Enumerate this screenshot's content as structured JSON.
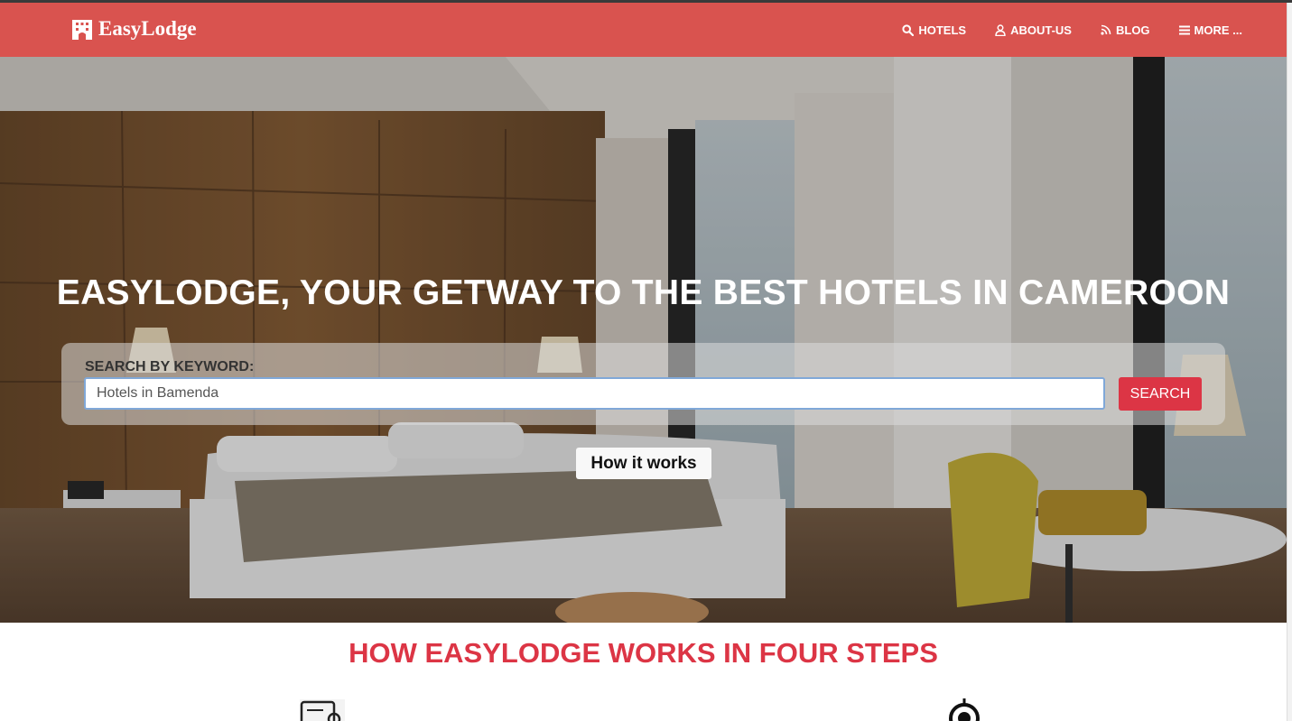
{
  "brand": {
    "name": "EasyLodge",
    "icon": "hotel-building-icon"
  },
  "nav": {
    "items": [
      {
        "label": "HOTELS",
        "icon": "search-icon"
      },
      {
        "label": "ABOUT-US",
        "icon": "user-icon"
      },
      {
        "label": "BLOG",
        "icon": "rss-icon"
      },
      {
        "label": "MORE ...",
        "icon": "menu-bars-icon"
      }
    ]
  },
  "hero": {
    "title": "EASYLODGE, YOUR GETWAY TO THE BEST HOTELS IN CAMEROON",
    "search": {
      "label": "SEARCH BY KEYWORD:",
      "placeholder": "Hotels in Bamenda",
      "button_label": "SEARCH"
    },
    "how_button_label": "How it works"
  },
  "steps": {
    "title": "HOW EASYLODGE WORKS IN FOUR STEPS",
    "icons": [
      "document-search-icon",
      "location-target-icon"
    ]
  },
  "colors": {
    "navbar": "#d9534f",
    "accent": "#dc3545",
    "white": "#ffffff"
  }
}
